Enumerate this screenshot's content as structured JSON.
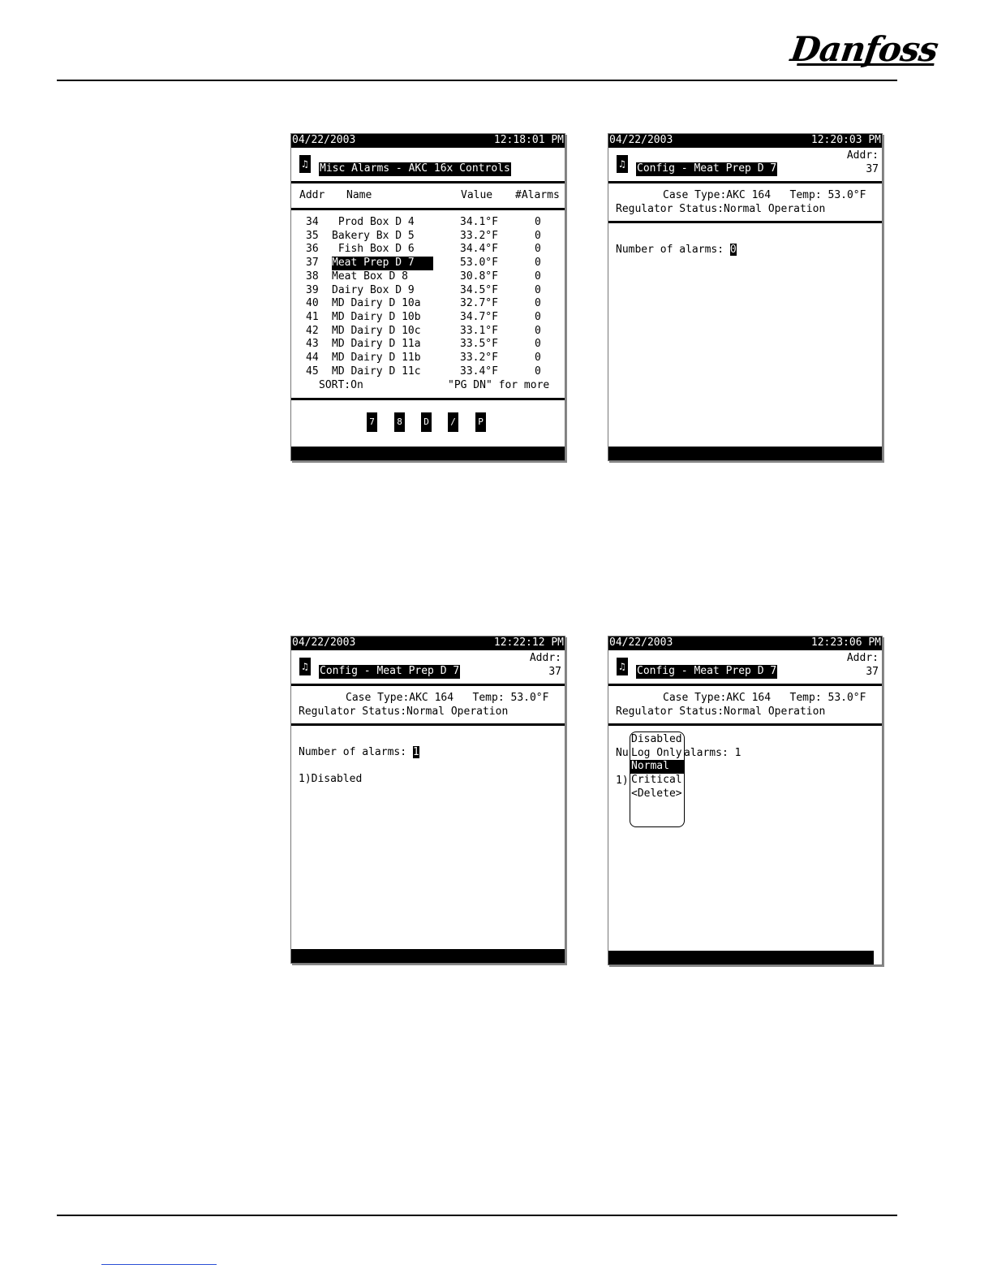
{
  "brand": {
    "logo_text": "Danfoss"
  },
  "screen1": {
    "date": "04/22/2003",
    "time": "12:18:01 PM",
    "title": "Misc Alarms - AKC 16x Controls",
    "headers": {
      "addr": "Addr",
      "name": "Name",
      "value": "Value",
      "alarms": "#Alarms"
    },
    "rows": [
      {
        "addr": "34",
        "name": " Prod Box D 4",
        "value": "34.1°F",
        "alarms": "0"
      },
      {
        "addr": "35",
        "name": "Bakery Bx D 5",
        "value": "33.2°F",
        "alarms": "0"
      },
      {
        "addr": "36",
        "name": " Fish Box D 6",
        "value": "34.4°F",
        "alarms": "0"
      },
      {
        "addr": "37",
        "name": "Meat Prep D 7",
        "value": "53.0°F",
        "alarms": "0"
      },
      {
        "addr": "38",
        "name": "Meat Box D 8",
        "value": "30.8°F",
        "alarms": "0"
      },
      {
        "addr": "39",
        "name": "Dairy Box D 9",
        "value": "34.5°F",
        "alarms": "0"
      },
      {
        "addr": "40",
        "name": "MD Dairy D 10a",
        "value": "32.7°F",
        "alarms": "0"
      },
      {
        "addr": "41",
        "name": "MD Dairy D 10b",
        "value": "34.7°F",
        "alarms": "0"
      },
      {
        "addr": "42",
        "name": "MD Dairy D 10c",
        "value": "33.1°F",
        "alarms": "0"
      },
      {
        "addr": "43",
        "name": "MD Dairy D 11a",
        "value": "33.5°F",
        "alarms": "0"
      },
      {
        "addr": "44",
        "name": "MD Dairy D 11b",
        "value": "33.2°F",
        "alarms": "0"
      },
      {
        "addr": "45",
        "name": "MD Dairy D 11c",
        "value": "33.4°F",
        "alarms": "0"
      }
    ],
    "sort": "SORT:On",
    "more": "\"PG DN\" for more",
    "fkey_icons": [
      "f1-icon",
      "f2-icon",
      "f3-icon",
      "f4-icon",
      "f5-icon"
    ]
  },
  "screen2": {
    "date": "04/22/2003",
    "time": "12:20:03 PM",
    "title": "Config - Meat Prep D 7",
    "addr_label": "Addr:",
    "addr_value": "37",
    "case_line": "Case Type:AKC 164   Temp: 53.0°F",
    "status_line": "Regulator Status:Normal Operation",
    "alarms_label": "Number of alarms: ",
    "alarms_value": "0"
  },
  "screen3": {
    "date": "04/22/2003",
    "time": "12:22:12 PM",
    "title": "Config - Meat Prep D 7",
    "addr_label": "Addr:",
    "addr_value": "37",
    "case_line": "Case Type:AKC 164   Temp: 53.0°F",
    "status_line": "Regulator Status:Normal Operation",
    "alarms_label": "Number of alarms: ",
    "alarms_value": "1",
    "entry": "1)Disabled"
  },
  "screen4": {
    "date": "04/22/2003",
    "time": "12:23:06 PM",
    "title": "Config - Meat Prep D 7",
    "addr_label": "Addr:",
    "addr_value": "37",
    "case_line": "Case Type:AKC 164   Temp: 53.0°F",
    "status_line": "Regulator Status:Normal Operation",
    "alarms_prefix": "Nu",
    "alarms_suffix": "alarms: 1",
    "entry_prefix": "1)",
    "popup_options": [
      "Disabled",
      "Log Only",
      "Normal",
      "Critical",
      "<Delete>"
    ],
    "popup_selected": "Normal"
  }
}
